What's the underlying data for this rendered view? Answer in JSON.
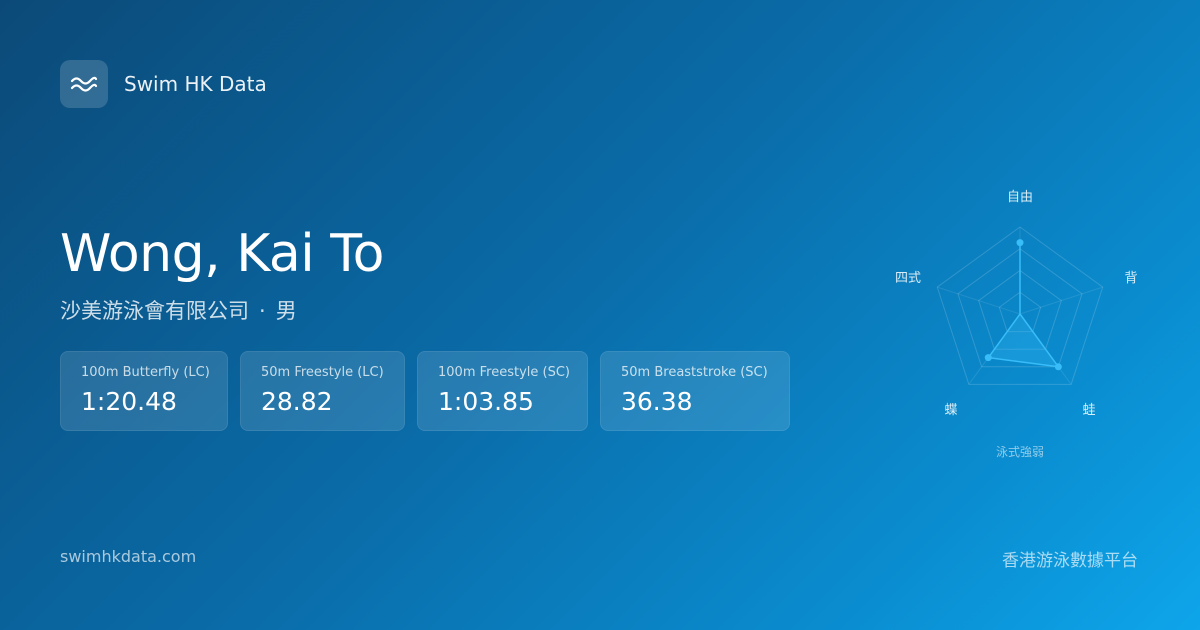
{
  "brand": {
    "logo_icon": "wave-icon",
    "name": "Swim HK Data"
  },
  "swimmer": {
    "name": "Wong, Kai To",
    "club": "沙美游泳會有限公司",
    "separator": "·",
    "gender": "男"
  },
  "best_times": [
    {
      "event": "100m Butterfly (LC)",
      "time": "1:20.48"
    },
    {
      "event": "50m Freestyle (LC)",
      "time": "28.82"
    },
    {
      "event": "100m Freestyle (SC)",
      "time": "1:03.85"
    },
    {
      "event": "50m Breaststroke (SC)",
      "time": "36.38"
    }
  ],
  "chart_data": {
    "type": "radar",
    "title": "泳式強弱",
    "axes": [
      "自由",
      "背",
      "蛙",
      "蝶",
      "四式"
    ],
    "values": [
      0.82,
      0.0,
      0.75,
      0.62,
      0.0
    ],
    "range": [
      0,
      1
    ],
    "rings": 4,
    "grid": true,
    "accent_color": "#38bdf8"
  },
  "footer": {
    "website": "swimhkdata.com",
    "tagline": "香港游泳數據平台"
  }
}
